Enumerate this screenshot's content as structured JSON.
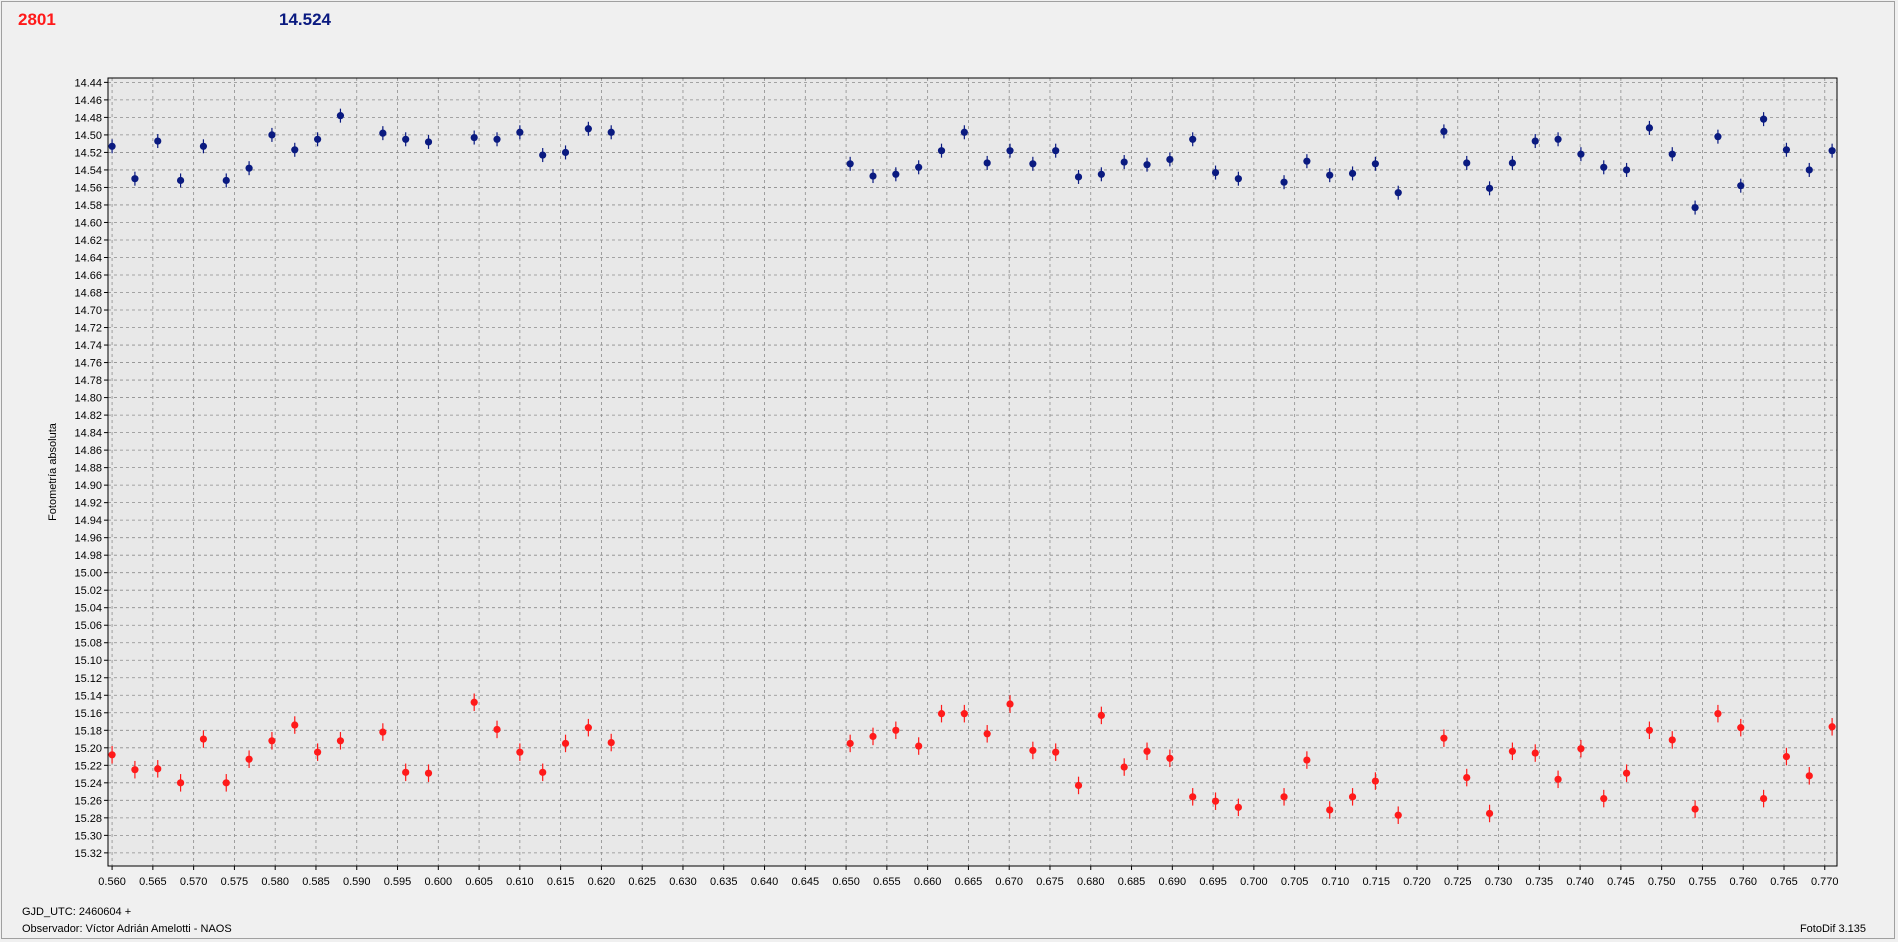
{
  "header": {
    "left_value": "2801",
    "right_value": "14.524"
  },
  "footer": {
    "gjd": "GJD_UTC: 2460604 +",
    "observer": "Observador: Víctor Adrián Amelotti - NAOS",
    "version": "FotoDif 3.135"
  },
  "colors": {
    "series_blue": "#0a1a80",
    "series_red": "#ff1a1a",
    "grid": "#8c8c8c",
    "plot_bg": "#e8e8e8"
  },
  "chart_data": {
    "type": "scatter",
    "ylabel": "Fotometría absoluta",
    "xlabel": "",
    "xlim": [
      0.5595,
      0.7715
    ],
    "ylim": [
      15.335,
      14.435
    ],
    "y_inverted": true,
    "x_ticks": [
      "0.560",
      "0.565",
      "0.570",
      "0.575",
      "0.580",
      "0.585",
      "0.590",
      "0.595",
      "0.600",
      "0.605",
      "0.610",
      "0.615",
      "0.620",
      "0.625",
      "0.630",
      "0.635",
      "0.640",
      "0.645",
      "0.650",
      "0.655",
      "0.660",
      "0.665",
      "0.670",
      "0.675",
      "0.680",
      "0.685",
      "0.690",
      "0.695",
      "0.700",
      "0.705",
      "0.710",
      "0.715",
      "0.720",
      "0.725",
      "0.730",
      "0.735",
      "0.740",
      "0.745",
      "0.750",
      "0.755",
      "0.760",
      "0.765",
      "0.770"
    ],
    "y_ticks": [
      "14.44",
      "14.46",
      "14.48",
      "14.50",
      "14.52",
      "14.54",
      "14.56",
      "14.58",
      "14.60",
      "14.62",
      "14.64",
      "14.66",
      "14.68",
      "14.70",
      "14.72",
      "14.74",
      "14.76",
      "14.78",
      "14.80",
      "14.82",
      "14.84",
      "14.86",
      "14.88",
      "14.90",
      "14.92",
      "14.94",
      "14.96",
      "14.98",
      "15.00",
      "15.02",
      "15.04",
      "15.06",
      "15.08",
      "15.10",
      "15.12",
      "15.14",
      "15.16",
      "15.18",
      "15.20",
      "15.22",
      "15.24",
      "15.26",
      "15.28",
      "15.30",
      "15.32"
    ],
    "grid": true,
    "series": [
      {
        "color": "#0a1a80",
        "error": 0.008,
        "x": [
          0.56,
          0.5628,
          0.5656,
          0.5684,
          0.5712,
          0.574,
          0.5768,
          0.5796,
          0.5824,
          0.5852,
          0.588,
          0.5932,
          0.596,
          0.5988,
          0.6044,
          0.6072,
          0.61,
          0.6128,
          0.6156,
          0.6184,
          0.6212,
          0.6505,
          0.6533,
          0.6561,
          0.6589,
          0.6617,
          0.6645,
          0.6673,
          0.6701,
          0.6729,
          0.6757,
          0.6785,
          0.6813,
          0.6841,
          0.6869,
          0.6897,
          0.6925,
          0.6953,
          0.6981,
          0.7037,
          0.7065,
          0.7093,
          0.7121,
          0.7149,
          0.7177,
          0.7233,
          0.7261,
          0.7289,
          0.7317,
          0.7345,
          0.7373,
          0.7401,
          0.7429,
          0.7457,
          0.7485,
          0.7513,
          0.7541,
          0.7569,
          0.7597,
          0.7625,
          0.7653,
          0.7681,
          0.7709
        ],
        "y": [
          14.513,
          14.55,
          14.507,
          14.552,
          14.513,
          14.552,
          14.538,
          14.5,
          14.517,
          14.505,
          14.478,
          14.498,
          14.505,
          14.508,
          14.503,
          14.505,
          14.497,
          14.523,
          14.52,
          14.493,
          14.497,
          14.533,
          14.547,
          14.545,
          14.537,
          14.518,
          14.497,
          14.532,
          14.518,
          14.533,
          14.518,
          14.548,
          14.545,
          14.531,
          14.534,
          14.528,
          14.505,
          14.543,
          14.55,
          14.554,
          14.53,
          14.546,
          14.544,
          14.533,
          14.566,
          14.496,
          14.532,
          14.561,
          14.532,
          14.507,
          14.505,
          14.522,
          14.537,
          14.54,
          14.492,
          14.522,
          14.583,
          14.502,
          14.558,
          14.482,
          14.517,
          14.54,
          14.518
        ]
      },
      {
        "color": "#ff1a1a",
        "error": 0.01,
        "x": [
          0.56,
          0.5628,
          0.5656,
          0.5684,
          0.5712,
          0.574,
          0.5768,
          0.5796,
          0.5824,
          0.5852,
          0.588,
          0.5932,
          0.596,
          0.5988,
          0.6044,
          0.6072,
          0.61,
          0.6128,
          0.6156,
          0.6184,
          0.6212,
          0.6505,
          0.6533,
          0.6561,
          0.6589,
          0.6617,
          0.6645,
          0.6673,
          0.6701,
          0.6729,
          0.6757,
          0.6785,
          0.6813,
          0.6841,
          0.6869,
          0.6897,
          0.6925,
          0.6953,
          0.6981,
          0.7037,
          0.7065,
          0.7093,
          0.7121,
          0.7149,
          0.7177,
          0.7233,
          0.7261,
          0.7289,
          0.7317,
          0.7345,
          0.7373,
          0.7401,
          0.7429,
          0.7457,
          0.7485,
          0.7513,
          0.7541,
          0.7569,
          0.7597,
          0.7625,
          0.7653,
          0.7681,
          0.7709
        ],
        "y": [
          15.208,
          15.225,
          15.224,
          15.24,
          15.19,
          15.24,
          15.213,
          15.192,
          15.174,
          15.205,
          15.192,
          15.182,
          15.228,
          15.229,
          15.148,
          15.179,
          15.205,
          15.228,
          15.195,
          15.177,
          15.194,
          15.195,
          15.187,
          15.18,
          15.198,
          15.161,
          15.161,
          15.184,
          15.15,
          15.203,
          15.205,
          15.243,
          15.163,
          15.222,
          15.204,
          15.212,
          15.256,
          15.261,
          15.268,
          15.256,
          15.214,
          15.271,
          15.256,
          15.238,
          15.277,
          15.189,
          15.234,
          15.275,
          15.204,
          15.206,
          15.236,
          15.201,
          15.258,
          15.229,
          15.18,
          15.191,
          15.27,
          15.161,
          15.177,
          15.258,
          15.21,
          15.232,
          15.176
        ]
      }
    ]
  }
}
